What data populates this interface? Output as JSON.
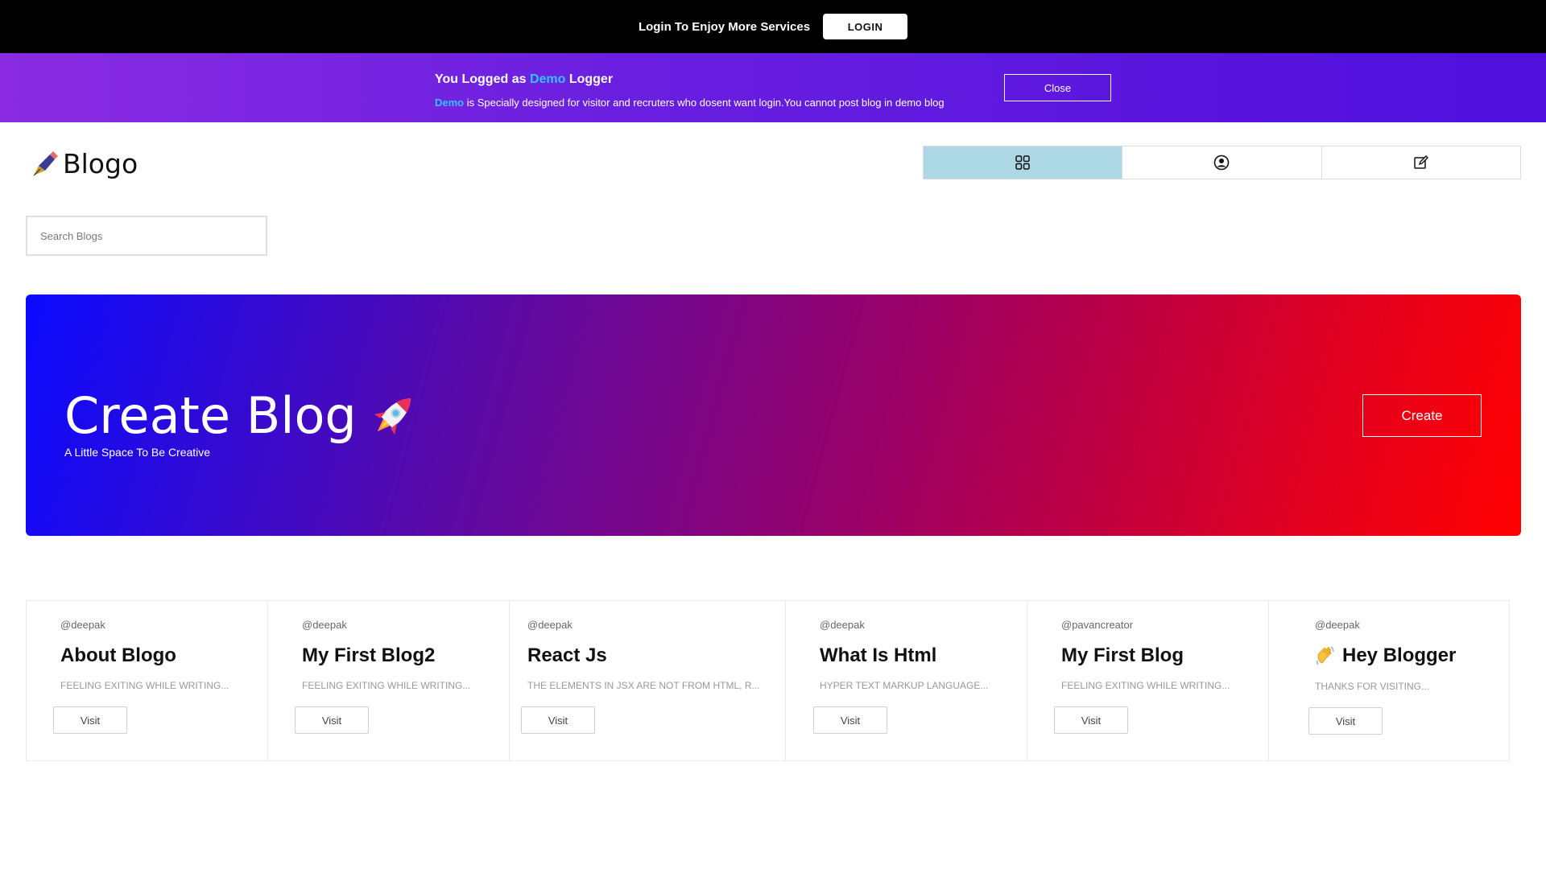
{
  "topbar": {
    "text": "Login To Enjoy More Services",
    "login_label": "LOGIN"
  },
  "banner": {
    "title_prefix": "You Logged as ",
    "title_highlight": "Demo",
    "title_suffix": " Logger",
    "desc_highlight": "Demo",
    "desc_text": " is Specially designed for visitor and recruters who dosent want login.You cannot post blog in demo blog",
    "close_label": "Close",
    "highlight_color": "#2ec5ff"
  },
  "header": {
    "logo_text": "Blogo",
    "nav": [
      {
        "icon": "grid-icon",
        "active": true
      },
      {
        "icon": "user-circle-icon",
        "active": false
      },
      {
        "icon": "edit-icon",
        "active": false
      }
    ],
    "active_color": "#add8e6"
  },
  "search": {
    "placeholder": "Search Blogs",
    "value": ""
  },
  "hero": {
    "title": "Create Blog",
    "subtitle": "A Little Space To Be Creative",
    "button_label": "Create",
    "gradient_start": "#0a0aff",
    "gradient_end": "#ff0000"
  },
  "cards": [
    {
      "author": "@deepak",
      "title": "About Blogo",
      "desc": "FEELING EXITING WHILE WRITING...",
      "visit": "Visit"
    },
    {
      "author": "@deepak",
      "title": "My First Blog2",
      "desc": "FEELING EXITING WHILE WRITING...",
      "visit": "Visit"
    },
    {
      "author": "@deepak",
      "title": "React Js",
      "desc": "THE ELEMENTS IN JSX ARE NOT FROM HTML, R...",
      "visit": "Visit"
    },
    {
      "author": "@deepak",
      "title": "What Is Html",
      "desc": "HYPER TEXT MARKUP LANGUAGE...",
      "visit": "Visit"
    },
    {
      "author": "@pavancreator",
      "title": "My First Blog",
      "desc": "FEELING EXITING WHILE WRITING...",
      "visit": "Visit"
    },
    {
      "author": "@deepak",
      "title": "Hey Blogger",
      "title_emoji": "wave-icon",
      "desc": "THANKS FOR VISITING...",
      "visit": "Visit"
    }
  ]
}
